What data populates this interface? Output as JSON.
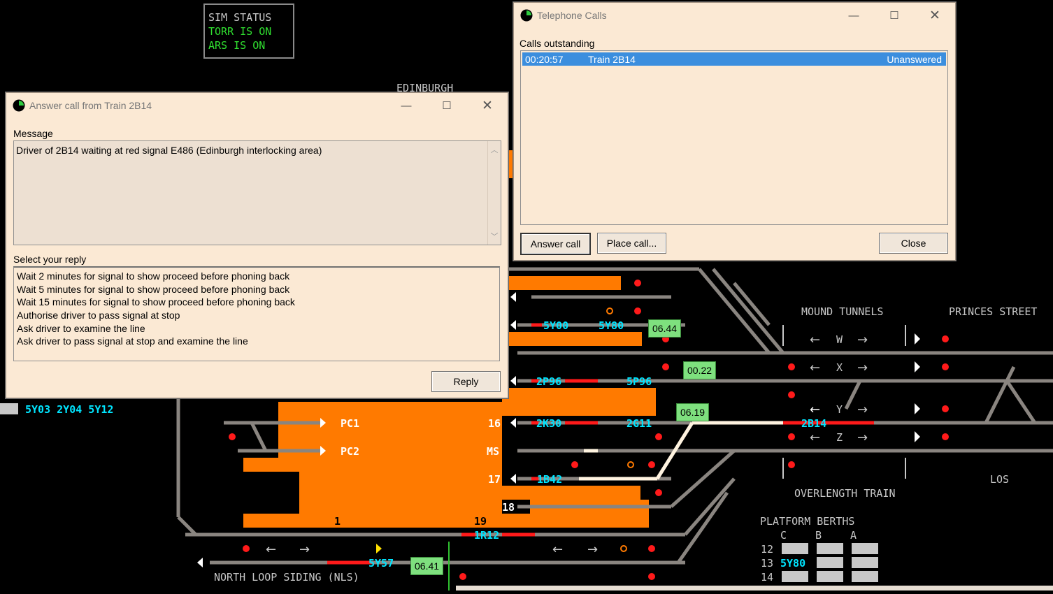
{
  "sim_status": {
    "title": "SIM STATUS",
    "torr": "TORR IS ON",
    "ars": "ARS  IS ON",
    "title_color": "#c8c8c8",
    "on_color": "#30e030"
  },
  "diagram": {
    "labels": {
      "edinburgh": "EDINBURGH",
      "mound_tunnels": "MOUND TUNNELS",
      "princes_street": "PRINCES STREET",
      "w": "W",
      "x": "X",
      "y": "Y",
      "z": "Z",
      "overlength_train": "OVERLENGTH TRAIN",
      "los": "LOS",
      "platform_berths": "PLATFORM BERTHS",
      "col_c": "C",
      "col_b": "B",
      "col_a": "A",
      "row_12": "12",
      "row_13": "13",
      "row_14": "14",
      "north_loop_siding": "NORTH LOOP SIDING (NLS)",
      "pc1": "PC1",
      "pc2": "PC2",
      "p16": "16",
      "ms": "MS",
      "p17": "17",
      "p18": "18",
      "p1": "1",
      "p19": "19"
    },
    "berths": {
      "b5y00": "5Y00",
      "b5y80": "5Y80",
      "b2p96": "2P96",
      "b5p96": "5P96",
      "b2k30": "2K30",
      "b2g11": "2G11",
      "b1b42": "1B42",
      "b1r12": "1R12",
      "b5y57": "5Y57",
      "b2b14": "2B14",
      "left_berths": "5Y03 2Y04 5Y12",
      "plat13_b": "5Y80"
    },
    "timers": {
      "t1": "06.44",
      "t2": "00.22",
      "t3": "06.19",
      "t4": "06.41"
    }
  },
  "answer_dialog": {
    "title": "Answer call from Train 2B14",
    "message_label": "Message",
    "message": "Driver of 2B14 waiting at red signal E486 (Edinburgh interlocking area)",
    "reply_label": "Select your reply",
    "replies": [
      "Wait 2 minutes for signal to show proceed before phoning back",
      "Wait 5 minutes for signal to show proceed before phoning back",
      "Wait 15 minutes for signal to show proceed before phoning back",
      "Authorise driver to pass signal at stop",
      "Ask driver to examine the line",
      "Ask driver to pass signal at stop and examine the line"
    ],
    "reply_button": "Reply"
  },
  "telephone_dialog": {
    "title": "Telephone Calls",
    "outstanding_label": "Calls outstanding",
    "calls": [
      {
        "time": "00:20:57",
        "train": "Train 2B14",
        "status": "Unanswered"
      }
    ],
    "answer_button": "Answer call",
    "place_button": "Place call...",
    "close_button": "Close"
  },
  "colors": {
    "track": "#8a8580",
    "platform": "#ff7a00",
    "signal_red": "#ff1a1a",
    "selection": "#3b8ede",
    "window_bg": "#fbe9d4"
  }
}
